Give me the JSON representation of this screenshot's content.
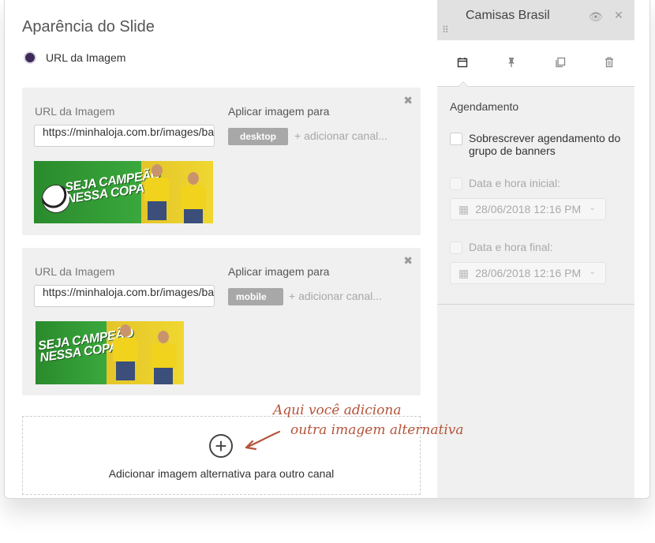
{
  "left_panel": {
    "section_title": "Aparência do Slide",
    "radio_label": "URL da Imagem",
    "cards": [
      {
        "url_label": "URL da Imagem",
        "url_value": "https://minhaloja.com.br/images/banner-copa-desktop.jpg",
        "apply_label": "Aplicar imagem para",
        "channel_chip": "desktop",
        "add_channel": "+ adicionar canal...",
        "banner_headline_1": "SEJA CAMPEÃO",
        "banner_headline_2": "NESSA COPA"
      },
      {
        "url_label": "URL da Imagem",
        "url_value": "https://minhaloja.com.br/images/banner-copa-mobile.jpg",
        "apply_label": "Aplicar imagem para",
        "channel_chip": "mobile",
        "add_channel": "+ adicionar canal...",
        "banner_headline_1": "SEJA CAMPEÃO",
        "banner_headline_2": "NESSA COPA"
      }
    ],
    "add_alternative_label": "Adicionar imagem alternativa para outro canal",
    "annotation_line_1": "Aqui você adiciona",
    "annotation_line_2": "outra imagem alternativa"
  },
  "right_panel": {
    "title": "Camisas Brasil",
    "scheduling_title": "Agendamento",
    "override_label": "Sobrescrever agendamento do grupo de banners",
    "start_label": "Data e hora inicial:",
    "start_value": "28/06/2018 12:16 PM",
    "end_label": "Data e hora final:",
    "end_value": "28/06/2018 12:16 PM",
    "icons": [
      "calendar-icon",
      "pin-icon",
      "copy-icon",
      "trash-icon"
    ]
  },
  "colors": {
    "radio_selected": "#3d2a57",
    "annotation": "#b4543a",
    "chip_bg": "#a8a8a8",
    "panel_bg": "#f0f0f0"
  }
}
